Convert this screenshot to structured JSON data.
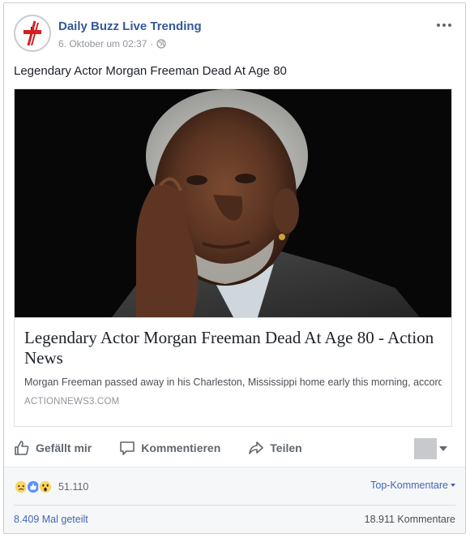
{
  "post": {
    "page_name": "Daily Buzz Live Trending",
    "timestamp": "6. Oktober um 02:37",
    "separator": "·",
    "privacy_icon": "globe-icon",
    "text": "Legendary Actor Morgan Freeman Dead At Age 80"
  },
  "link_preview": {
    "title": "Legendary Actor Morgan Freeman Dead At Age 80 - Action News",
    "description": "Morgan Freeman passed away in his Charleston, Mississippi home early this morning, according to his representatives. An investigation is underway, however…",
    "domain": "ACTIONNEWS3.COM"
  },
  "actions": {
    "like_label": "Gefällt mir",
    "comment_label": "Kommentieren",
    "share_label": "Teilen"
  },
  "footer": {
    "reaction_icons": [
      "sad-reaction-icon",
      "like-reaction-icon",
      "wow-reaction-icon"
    ],
    "reaction_count": "51.110",
    "top_comments_label": "Top-Kommentare",
    "shares_label": "8.409 Mal geteilt",
    "comments_label": "18.911 Kommentare"
  },
  "colors": {
    "page_name": "#365899",
    "link": "#4267b2",
    "like_blue": "#5890ff",
    "reaction_yellow": "#fcd561",
    "brand_red": "#d31f26"
  }
}
